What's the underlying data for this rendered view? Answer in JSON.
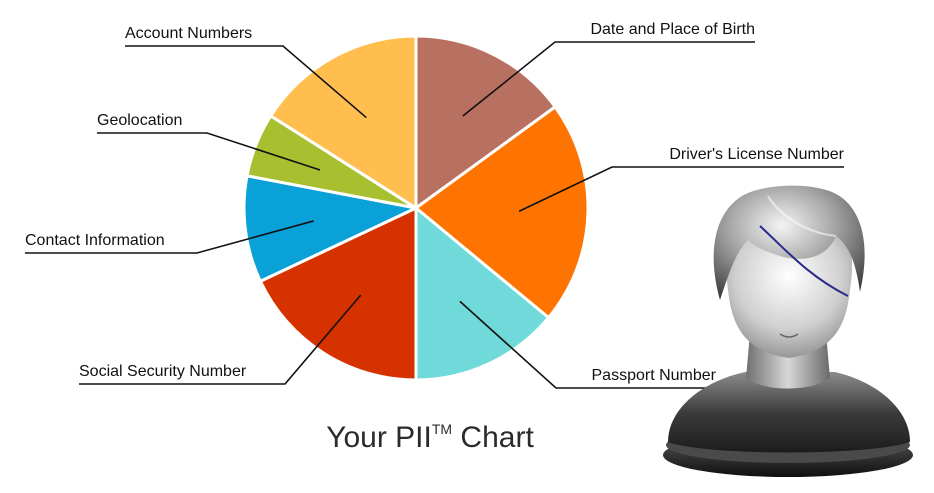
{
  "chart_data": {
    "type": "pie",
    "title": "Your PII",
    "title_superscript": "TM",
    "title_suffix": " Chart",
    "slices": [
      {
        "label": "Date and Place of Birth",
        "value": 15,
        "color": "#b87060"
      },
      {
        "label": "Driver's License Number",
        "value": 21,
        "color": "#ff7300"
      },
      {
        "label": "Passport Number",
        "value": 14,
        "color": "#70dada"
      },
      {
        "label": "Social Security Number",
        "value": 18,
        "color": "#d63200"
      },
      {
        "label": "Contact Information",
        "value": 10,
        "color": "#0aa0d8"
      },
      {
        "label": "Geolocation",
        "value": 6,
        "color": "#a8c030"
      },
      {
        "label": "Account Numbers",
        "value": 16,
        "color": "#ffbe4e"
      }
    ],
    "legend": "none",
    "labels": "callout lines"
  },
  "illustration": {
    "icon": "user-head-bust-icon"
  }
}
